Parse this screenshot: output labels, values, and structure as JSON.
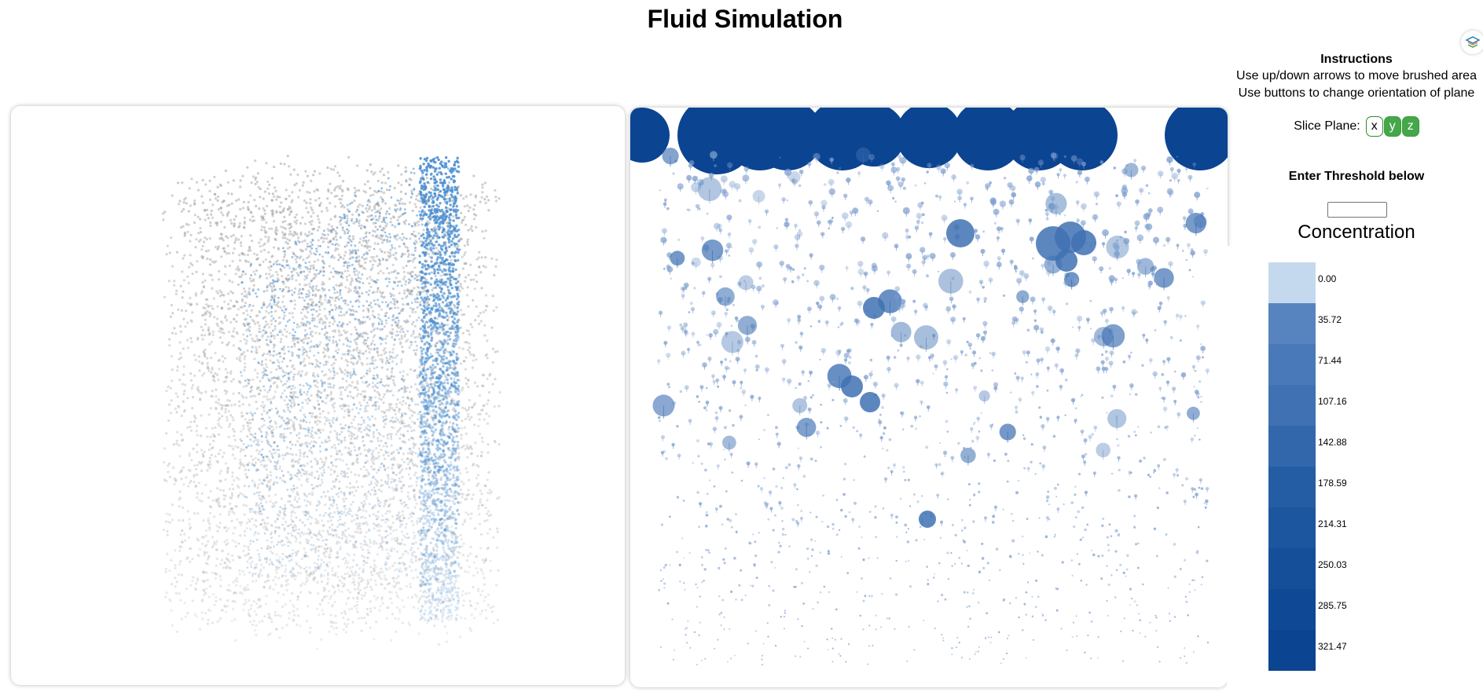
{
  "page": {
    "title": "Fluid Simulation"
  },
  "instructions": {
    "heading": "Instructions",
    "line1": "Use up/down arrows to move brushed area",
    "line2": "Use buttons to change orientation of plane"
  },
  "slice_plane": {
    "label": "Slice Plane:",
    "options": [
      "x",
      "y",
      "z"
    ],
    "selected": "x"
  },
  "threshold": {
    "heading": "Enter Threshold below",
    "value": ""
  },
  "legend": {
    "title": "Concentration",
    "bins": [
      "0.00",
      "35.72",
      "71.44",
      "107.16",
      "142.88",
      "178.59",
      "214.31",
      "250.03",
      "285.75",
      "321.47"
    ],
    "colors": [
      "#c4d9ee",
      "#5784bf",
      "#4a79ba",
      "#3f71b3",
      "#3267ac",
      "#255da5",
      "#1c569f",
      "#154f99",
      "#0f4995",
      "#0b4491"
    ]
  },
  "colors": {
    "particle_gray": "#9a9a9a",
    "particle_blue": "#4b8fd1",
    "glyph_blue": "#7f9fcf",
    "glyph_dark": "#0b4491",
    "button_green": "#46a64a"
  },
  "icons": {
    "corner": "layers-icon"
  }
}
